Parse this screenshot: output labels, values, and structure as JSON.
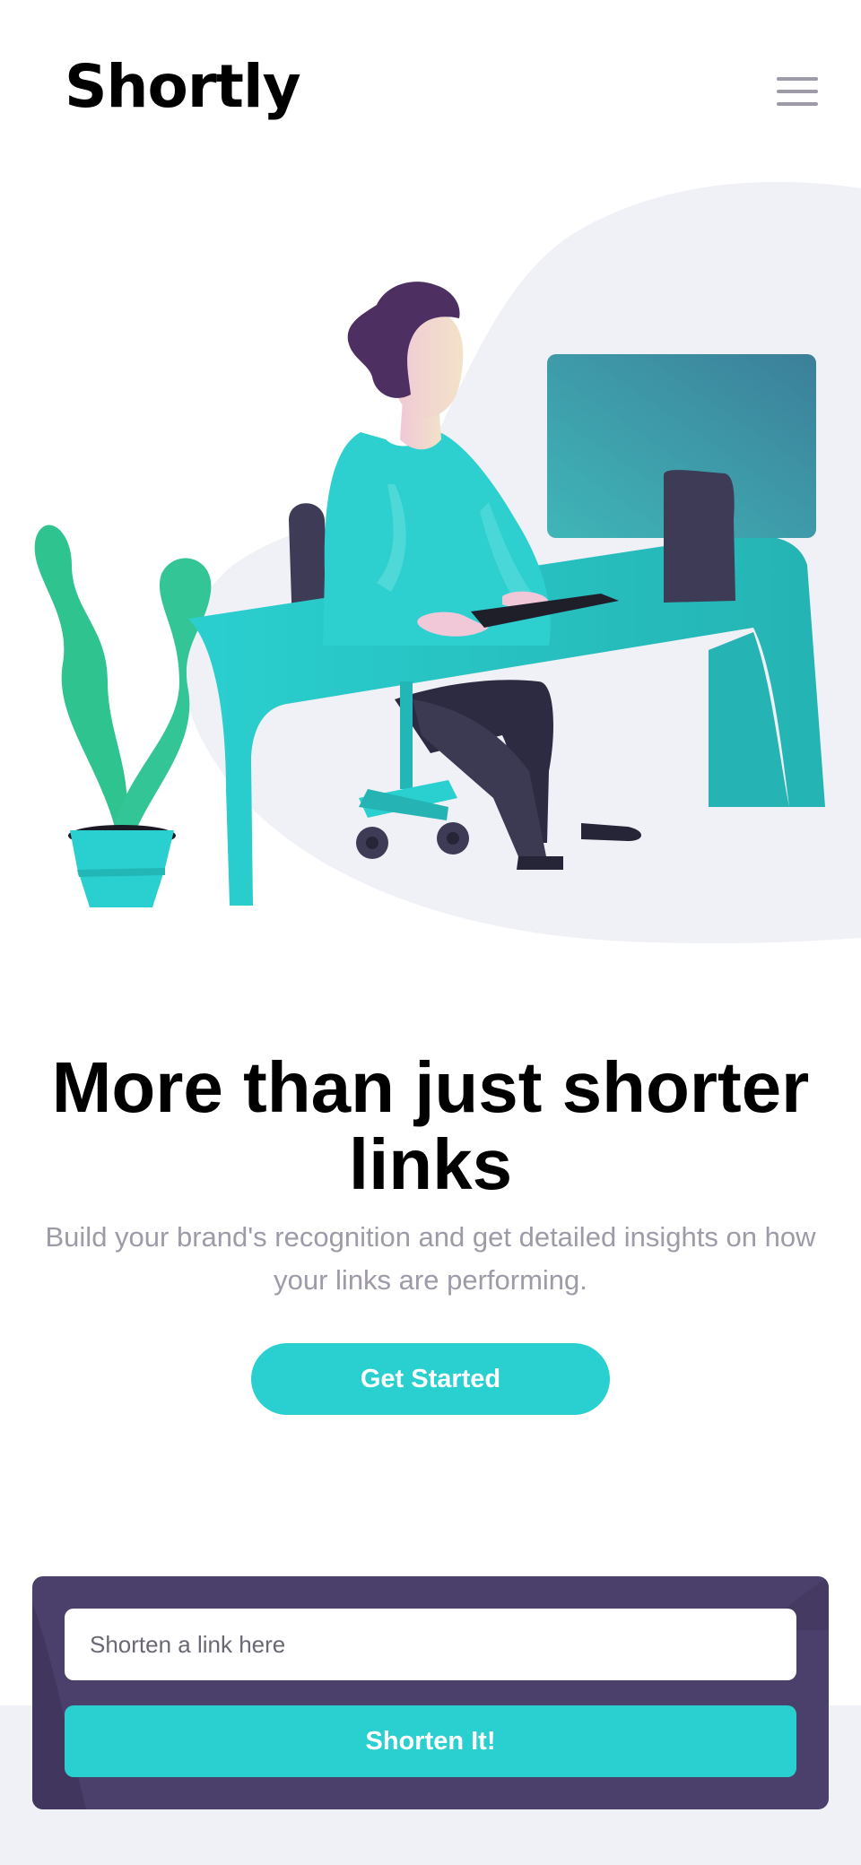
{
  "brand": {
    "logo_text": "Shortly",
    "accent": "#2acfcf",
    "dark_violet": "#4b3f6b"
  },
  "header": {
    "menu_icon": "hamburger-icon"
  },
  "hero": {
    "illustration": "person-working-icon",
    "headline": "More than just shorter links",
    "subtitle": "Build your brand's recognition and get detailed insights on how your links are performing.",
    "cta_label": "Get Started"
  },
  "shorten": {
    "input_value": "",
    "input_placeholder": "Shorten a link here",
    "button_label": "Shorten It!"
  }
}
